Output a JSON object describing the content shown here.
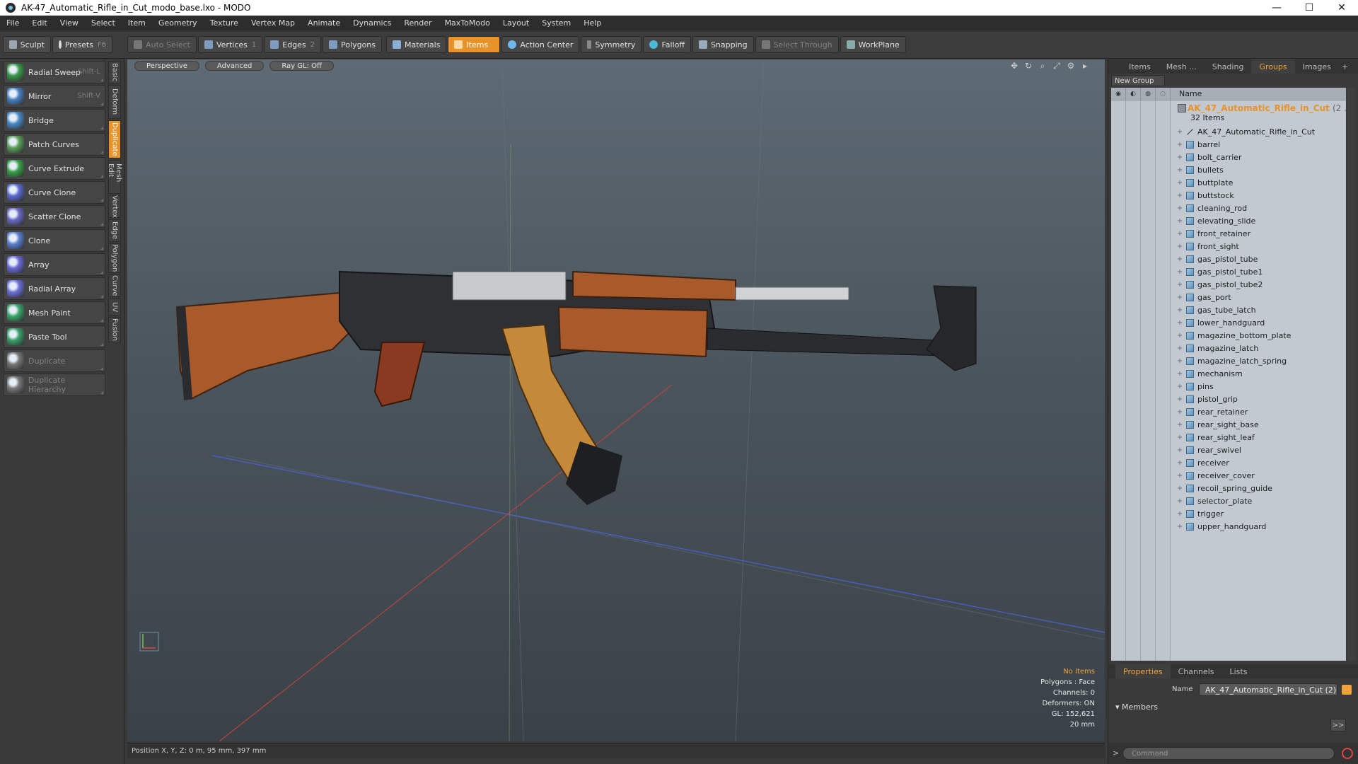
{
  "window": {
    "title": "AK-47_Automatic_Rifle_in_Cut_modo_base.lxo - MODO",
    "minimize": "—",
    "maximize": "☐",
    "close": "✕"
  },
  "menu": [
    "File",
    "Edit",
    "View",
    "Select",
    "Item",
    "Geometry",
    "Texture",
    "Vertex Map",
    "Animate",
    "Dynamics",
    "Render",
    "MaxToModo",
    "Layout",
    "System",
    "Help"
  ],
  "toolbar": {
    "sculpt": "Sculpt",
    "presets": "Presets",
    "presets_shortcut": "F6",
    "auto_select": "Auto Select",
    "vertices": "Vertices",
    "vertices_num": "1",
    "edges": "Edges",
    "edges_num": "2",
    "polygons": "Polygons",
    "materials": "Materials",
    "items": "Items",
    "action_center": "Action Center",
    "symmetry": "Symmetry",
    "falloff": "Falloff",
    "snapping": "Snapping",
    "select_through": "Select Through",
    "workplane": "WorkPlane"
  },
  "tools": [
    {
      "label": "Radial Sweep",
      "shortcut": "Shift-L",
      "icon": "radial-sweep-icon",
      "disabled": false
    },
    {
      "label": "Mirror",
      "shortcut": "Shift-V",
      "icon": "mirror-icon",
      "disabled": false
    },
    {
      "label": "Bridge",
      "shortcut": "",
      "icon": "bridge-icon",
      "disabled": false
    },
    {
      "label": "Patch Curves",
      "shortcut": "",
      "icon": "patch-curves-icon",
      "disabled": false
    },
    {
      "label": "Curve Extrude",
      "shortcut": "",
      "icon": "curve-extrude-icon",
      "disabled": false
    },
    {
      "label": "Curve Clone",
      "shortcut": "",
      "icon": "curve-clone-icon",
      "disabled": false
    },
    {
      "label": "Scatter Clone",
      "shortcut": "",
      "icon": "scatter-clone-icon",
      "disabled": false
    },
    {
      "label": "Clone",
      "shortcut": "",
      "icon": "clone-icon",
      "disabled": false
    },
    {
      "label": "Array",
      "shortcut": "",
      "icon": "array-icon",
      "disabled": false
    },
    {
      "label": "Radial Array",
      "shortcut": "",
      "icon": "radial-array-icon",
      "disabled": false
    },
    {
      "label": "Mesh Paint",
      "shortcut": "",
      "icon": "mesh-paint-icon",
      "disabled": false
    },
    {
      "label": "Paste Tool",
      "shortcut": "",
      "icon": "paste-tool-icon",
      "disabled": false
    },
    {
      "label": "Duplicate",
      "shortcut": "",
      "icon": "duplicate-icon",
      "disabled": true
    },
    {
      "label": "Duplicate Hierarchy",
      "shortcut": "",
      "icon": "duplicate-hierarchy-icon",
      "disabled": true
    }
  ],
  "vtabs": [
    {
      "label": "Basic",
      "active": false
    },
    {
      "label": "Deform",
      "active": false
    },
    {
      "label": "Duplicate",
      "active": true
    },
    {
      "label": "Mesh Edit",
      "active": false
    },
    {
      "label": "Vertex",
      "active": false
    },
    {
      "label": "Edge",
      "active": false
    },
    {
      "label": "Polygon",
      "active": false
    },
    {
      "label": "Curve",
      "active": false
    },
    {
      "label": "UV",
      "active": false
    },
    {
      "label": "Fusion",
      "active": false
    }
  ],
  "viewport": {
    "view": "Perspective",
    "shading": "Advanced",
    "raygl": "Ray GL: Off",
    "stats": {
      "items": "No Items",
      "polygons": "Polygons : Face",
      "channels": "Channels: 0",
      "deformers": "Deformers: ON",
      "gl": "GL: 152,621",
      "grid": "20 mm"
    }
  },
  "status": {
    "position": "Position X, Y, Z:  0 m, 95 mm, 397 mm"
  },
  "right_tabs": [
    {
      "label": "Items",
      "active": false
    },
    {
      "label": "Mesh ...",
      "active": false
    },
    {
      "label": "Shading",
      "active": false
    },
    {
      "label": "Groups",
      "active": true
    },
    {
      "label": "Images",
      "active": false
    }
  ],
  "groups": {
    "new_group": "New Group",
    "header_name": "Name",
    "group_name": "AK_47_Automatic_Rifle_in_Cut",
    "group_suffix": "(2 ...",
    "group_count": "32 Items",
    "items": [
      {
        "name": "AK_47_Automatic_Rifle_in_Cut",
        "type": "locator"
      },
      {
        "name": "barrel",
        "type": "mesh"
      },
      {
        "name": "bolt_carrier",
        "type": "mesh"
      },
      {
        "name": "bullets",
        "type": "mesh"
      },
      {
        "name": "buttplate",
        "type": "mesh"
      },
      {
        "name": "buttstock",
        "type": "mesh"
      },
      {
        "name": "cleaning_rod",
        "type": "mesh"
      },
      {
        "name": "elevating_slide",
        "type": "mesh"
      },
      {
        "name": "front_retainer",
        "type": "mesh"
      },
      {
        "name": "front_sight",
        "type": "mesh"
      },
      {
        "name": "gas_pistol_tube",
        "type": "mesh"
      },
      {
        "name": "gas_pistol_tube1",
        "type": "mesh"
      },
      {
        "name": "gas_pistol_tube2",
        "type": "mesh"
      },
      {
        "name": "gas_port",
        "type": "mesh"
      },
      {
        "name": "gas_tube_latch",
        "type": "mesh"
      },
      {
        "name": "lower_handguard",
        "type": "mesh"
      },
      {
        "name": "magazine_bottom_plate",
        "type": "mesh"
      },
      {
        "name": "magazine_latch",
        "type": "mesh"
      },
      {
        "name": "magazine_latch_spring",
        "type": "mesh"
      },
      {
        "name": "mechanism",
        "type": "mesh"
      },
      {
        "name": "pins",
        "type": "mesh"
      },
      {
        "name": "pistol_grip",
        "type": "mesh"
      },
      {
        "name": "rear_retainer",
        "type": "mesh"
      },
      {
        "name": "rear_sight_base",
        "type": "mesh"
      },
      {
        "name": "rear_sight_leaf",
        "type": "mesh"
      },
      {
        "name": "rear_swivel",
        "type": "mesh"
      },
      {
        "name": "receiver",
        "type": "mesh"
      },
      {
        "name": "receiver_cover",
        "type": "mesh"
      },
      {
        "name": "recoil_spring_guide",
        "type": "mesh"
      },
      {
        "name": "selector_plate",
        "type": "mesh"
      },
      {
        "name": "trigger",
        "type": "mesh"
      },
      {
        "name": "upper_handguard",
        "type": "mesh"
      }
    ]
  },
  "properties": {
    "tabs": [
      {
        "label": "Properties",
        "active": true
      },
      {
        "label": "Channels",
        "active": false
      },
      {
        "label": "Lists",
        "active": false
      }
    ],
    "name_label": "Name",
    "name_value": "AK_47_Automatic_Rifle_in_Cut (2)",
    "members": "Members",
    "forward": ">>"
  },
  "command": {
    "prompt": ">",
    "placeholder": "Command"
  },
  "colors": {
    "accent": "#e8922a",
    "wood": "#a85a2a",
    "metal": "#2e3034",
    "brass": "#c48a3a"
  }
}
